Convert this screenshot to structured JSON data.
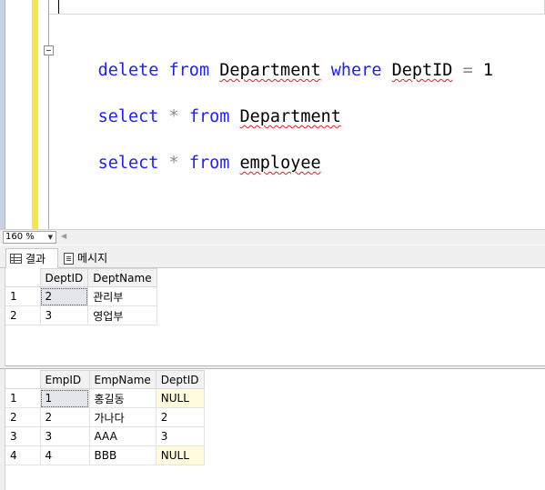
{
  "editor": {
    "lines": [
      {
        "tokens": [
          {
            "t": "delete",
            "c": "kw"
          },
          {
            "t": " ",
            "c": "sp"
          },
          {
            "t": "from",
            "c": "kw"
          },
          {
            "t": " ",
            "c": "sp"
          },
          {
            "t": "Department",
            "c": "id"
          },
          {
            "t": " ",
            "c": "sp"
          },
          {
            "t": "where",
            "c": "kw"
          },
          {
            "t": " ",
            "c": "sp"
          },
          {
            "t": "DeptID",
            "c": "id"
          },
          {
            "t": " ",
            "c": "sp"
          },
          {
            "t": "=",
            "c": "op"
          },
          {
            "t": " ",
            "c": "sp"
          },
          {
            "t": "1",
            "c": "num"
          }
        ]
      },
      {
        "tokens": [
          {
            "t": "select",
            "c": "kw"
          },
          {
            "t": " ",
            "c": "sp"
          },
          {
            "t": "*",
            "c": "op"
          },
          {
            "t": " ",
            "c": "sp"
          },
          {
            "t": "from",
            "c": "kw"
          },
          {
            "t": " ",
            "c": "sp"
          },
          {
            "t": "Department",
            "c": "id"
          }
        ]
      },
      {
        "tokens": [
          {
            "t": "select",
            "c": "kw"
          },
          {
            "t": " ",
            "c": "sp"
          },
          {
            "t": "*",
            "c": "op"
          },
          {
            "t": " ",
            "c": "sp"
          },
          {
            "t": "from",
            "c": "kw"
          },
          {
            "t": " ",
            "c": "sp"
          },
          {
            "t": "employee",
            "c": "id"
          }
        ]
      }
    ]
  },
  "zoom": {
    "value": "160 %"
  },
  "tabs": [
    {
      "label": "결과",
      "icon": "grid-icon",
      "active": true
    },
    {
      "label": "메시지",
      "icon": "message-icon",
      "active": false
    }
  ],
  "results": [
    {
      "columns": [
        "DeptID",
        "DeptName"
      ],
      "rows": [
        {
          "num": "1",
          "cells": [
            "2",
            "관리부"
          ]
        },
        {
          "num": "2",
          "cells": [
            "3",
            "영업부"
          ]
        }
      ]
    },
    {
      "columns": [
        "EmpID",
        "EmpName",
        "DeptID"
      ],
      "rows": [
        {
          "num": "1",
          "cells": [
            "1",
            "홍길동",
            "NULL"
          ]
        },
        {
          "num": "2",
          "cells": [
            "2",
            "가나다",
            "2"
          ]
        },
        {
          "num": "3",
          "cells": [
            "3",
            "AAA",
            "3"
          ]
        },
        {
          "num": "4",
          "cells": [
            "4",
            "BBB",
            "NULL"
          ]
        }
      ]
    }
  ]
}
